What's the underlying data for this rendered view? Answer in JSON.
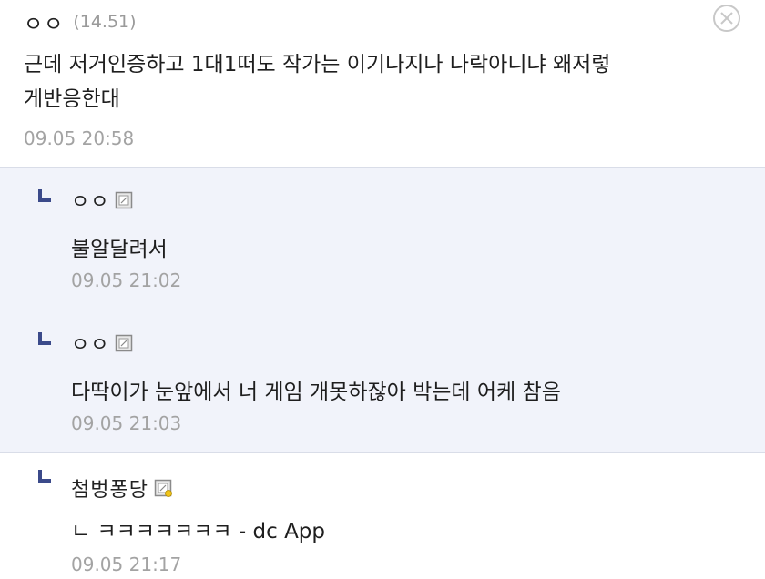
{
  "comment": {
    "nick": "ㅇㅇ",
    "ip": "(14.51)",
    "lines": [
      "근데 저거인증하고 1대1떠도 작가는 이기나지나 나락아니냐 왜저렇",
      "게반응한대"
    ],
    "date": "09.05 20:58"
  },
  "replies": [
    {
      "nick": "ㅇㅇ",
      "text": "불알달려서",
      "date": "09.05 21:02",
      "badge": "mobile-icon"
    },
    {
      "nick": "ㅇㅇ",
      "text": "다딱이가 눈앞에서 너 게임 개못하잖아 박는데 어케 참음",
      "date": "09.05 21:03",
      "badge": "mobile-icon"
    },
    {
      "nick": "첨벙퐁당",
      "text": "ㄴ ㅋㅋㅋㅋㅋㅋㅋ - dc App",
      "date": "09.05 21:17",
      "badge": "fixed-nick-icon"
    }
  ],
  "colors": {
    "reply_bg": "#f1f3fa",
    "divider": "#d9dde8",
    "date": "#a3a3a3",
    "arrow": "#3b4a8a"
  }
}
